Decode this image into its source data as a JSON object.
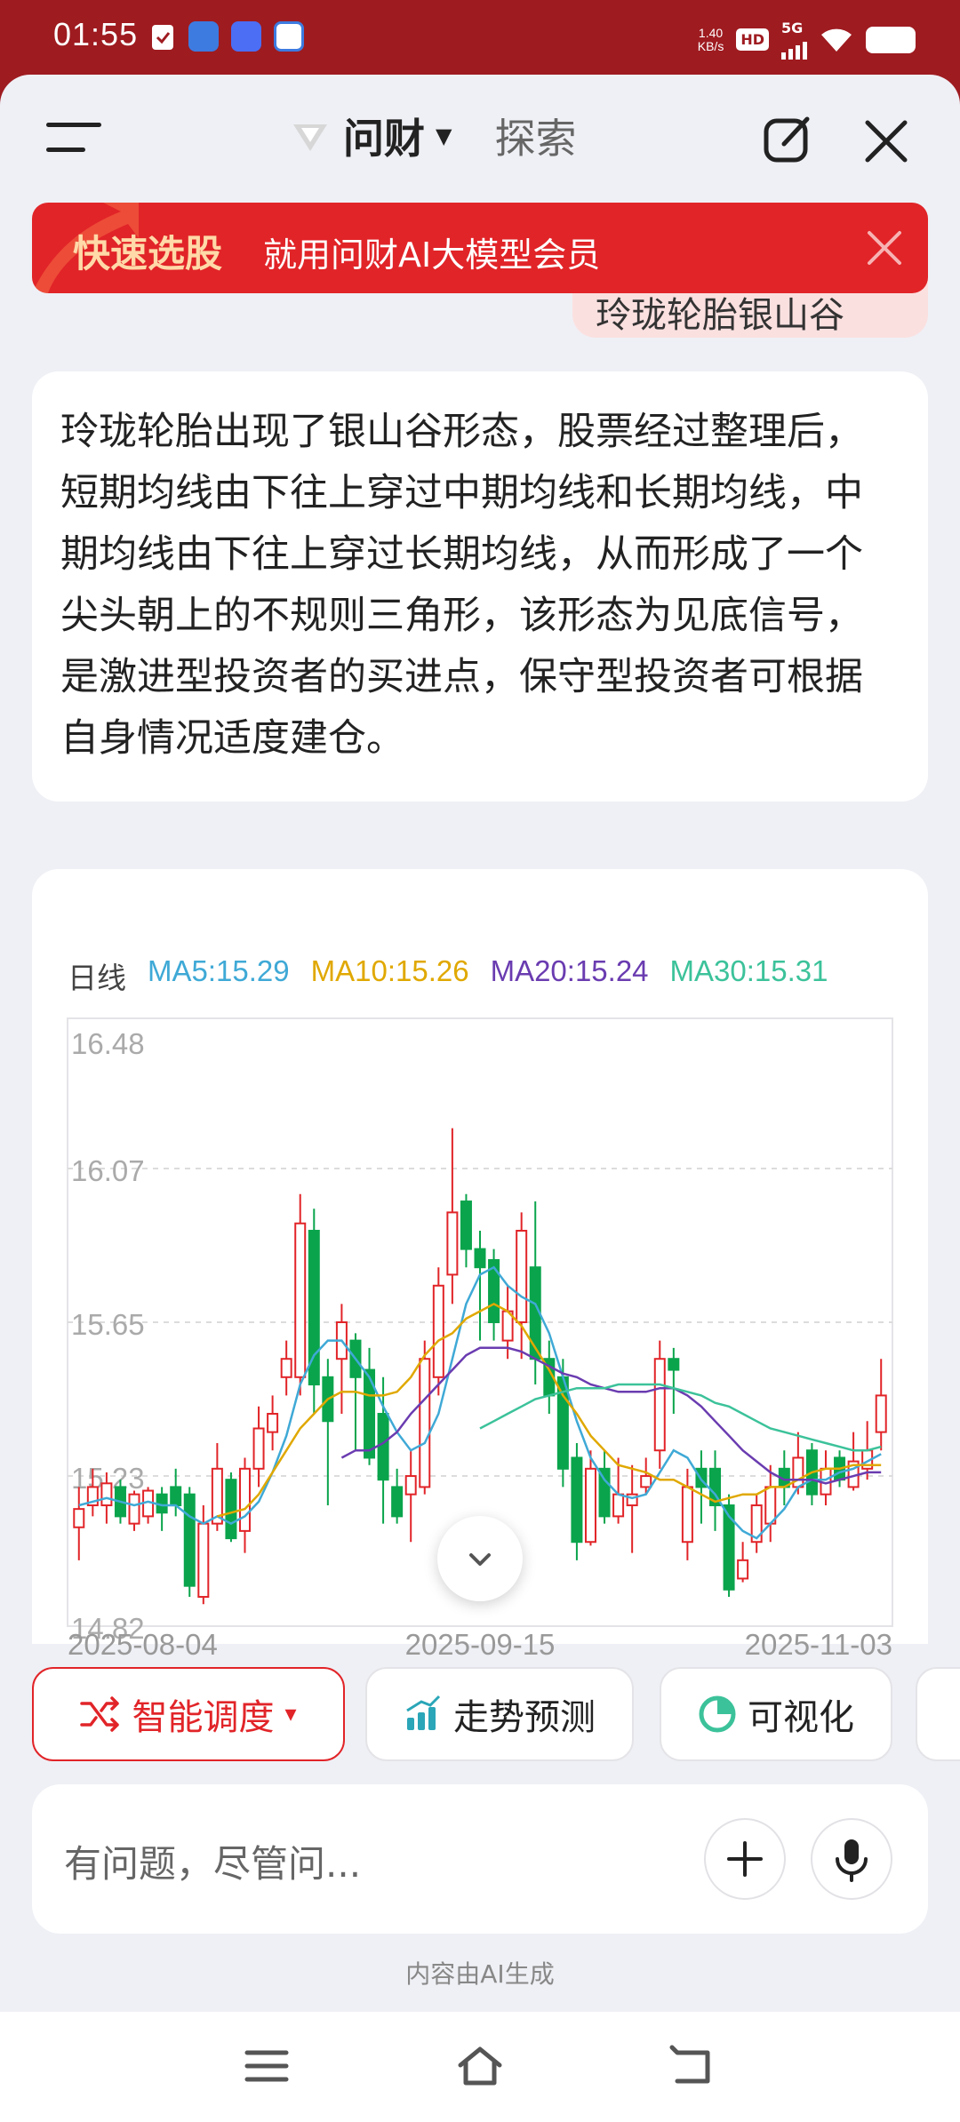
{
  "status_bar": {
    "time": "01:55",
    "net_speed_top": "1.40",
    "net_speed_unit": "KB/s",
    "hd": "HD",
    "network": "5G"
  },
  "header": {
    "brand": "问财",
    "explore": "探索"
  },
  "user_message": {
    "text": "玲珑轮胎银山谷"
  },
  "promo": {
    "title": "快速选股",
    "subtitle": "就用问财AI大模型会员"
  },
  "answer": {
    "text": "玲珑轮胎出现了银山谷形态，股票经过整理后，短期均线由下往上穿过中期均线和长期均线，中期均线由下往上穿过长期均线，从而形成了一个尖头朝上的不规则三角形，该形态为见底信号，是激进型投资者的买进点，保守型投资者可根据自身情况适度建仓。"
  },
  "chart_data": {
    "type": "candlestick",
    "period_label": "日线",
    "ma_legend": [
      {
        "label": "MA5:15.29",
        "color": "#3fa9d6"
      },
      {
        "label": "MA10:15.26",
        "color": "#e0a800"
      },
      {
        "label": "MA20:15.24",
        "color": "#6a3cb0"
      },
      {
        "label": "MA30:15.31",
        "color": "#3cc29a"
      }
    ],
    "y_ticks": [
      "16.48",
      "16.07",
      "15.65",
      "15.23",
      "14.82"
    ],
    "ylim": [
      14.82,
      16.48
    ],
    "x_ticks": [
      "2025-08-04",
      "2025-09-15",
      "2025-11-03"
    ],
    "up_color": "#e12428",
    "down_color": "#0aa44c",
    "candles": [
      {
        "o": 15.09,
        "c": 15.14,
        "h": 15.2,
        "l": 15.0
      },
      {
        "o": 15.15,
        "c": 15.2,
        "h": 15.25,
        "l": 15.12
      },
      {
        "o": 15.15,
        "c": 15.21,
        "h": 15.24,
        "l": 15.1
      },
      {
        "o": 15.2,
        "c": 15.12,
        "h": 15.22,
        "l": 15.1
      },
      {
        "o": 15.1,
        "c": 15.18,
        "h": 15.19,
        "l": 15.08
      },
      {
        "o": 15.12,
        "c": 15.19,
        "h": 15.2,
        "l": 15.1
      },
      {
        "o": 15.18,
        "c": 15.13,
        "h": 15.2,
        "l": 15.08
      },
      {
        "o": 15.2,
        "c": 15.15,
        "h": 15.25,
        "l": 15.12
      },
      {
        "o": 15.18,
        "c": 14.93,
        "h": 15.2,
        "l": 14.9
      },
      {
        "o": 14.9,
        "c": 15.1,
        "h": 15.15,
        "l": 14.88
      },
      {
        "o": 15.1,
        "c": 15.25,
        "h": 15.32,
        "l": 15.08
      },
      {
        "o": 15.22,
        "c": 15.06,
        "h": 15.24,
        "l": 15.05
      },
      {
        "o": 15.08,
        "c": 15.25,
        "h": 15.28,
        "l": 15.02
      },
      {
        "o": 15.25,
        "c": 15.36,
        "h": 15.42,
        "l": 15.2
      },
      {
        "o": 15.35,
        "c": 15.4,
        "h": 15.45,
        "l": 15.3
      },
      {
        "o": 15.5,
        "c": 15.55,
        "h": 15.6,
        "l": 15.45
      },
      {
        "o": 15.5,
        "c": 15.92,
        "h": 16.0,
        "l": 15.45
      },
      {
        "o": 15.9,
        "c": 15.48,
        "h": 15.96,
        "l": 15.4
      },
      {
        "o": 15.5,
        "c": 15.38,
        "h": 15.55,
        "l": 15.15
      },
      {
        "o": 15.55,
        "c": 15.65,
        "h": 15.7,
        "l": 15.4
      },
      {
        "o": 15.6,
        "c": 15.5,
        "h": 15.62,
        "l": 15.3
      },
      {
        "o": 15.52,
        "c": 15.28,
        "h": 15.58,
        "l": 15.26
      },
      {
        "o": 15.4,
        "c": 15.22,
        "h": 15.5,
        "l": 15.1
      },
      {
        "o": 15.2,
        "c": 15.12,
        "h": 15.25,
        "l": 15.1
      },
      {
        "o": 15.18,
        "c": 15.23,
        "h": 15.3,
        "l": 15.05
      },
      {
        "o": 15.2,
        "c": 15.55,
        "h": 15.6,
        "l": 15.18
      },
      {
        "o": 15.5,
        "c": 15.75,
        "h": 15.8,
        "l": 15.45
      },
      {
        "o": 15.78,
        "c": 15.95,
        "h": 16.18,
        "l": 15.7
      },
      {
        "o": 15.98,
        "c": 15.85,
        "h": 16.0,
        "l": 15.8
      },
      {
        "o": 15.85,
        "c": 15.8,
        "h": 15.9,
        "l": 15.6
      },
      {
        "o": 15.82,
        "c": 15.65,
        "h": 15.85,
        "l": 15.6
      },
      {
        "o": 15.6,
        "c": 15.68,
        "h": 15.75,
        "l": 15.55
      },
      {
        "o": 15.65,
        "c": 15.9,
        "h": 15.95,
        "l": 15.55
      },
      {
        "o": 15.8,
        "c": 15.55,
        "h": 15.98,
        "l": 15.48
      },
      {
        "o": 15.55,
        "c": 15.45,
        "h": 15.6,
        "l": 15.4
      },
      {
        "o": 15.5,
        "c": 15.25,
        "h": 15.55,
        "l": 15.2
      },
      {
        "o": 15.28,
        "c": 15.05,
        "h": 15.32,
        "l": 15.0
      },
      {
        "o": 15.05,
        "c": 15.25,
        "h": 15.3,
        "l": 15.04
      },
      {
        "o": 15.25,
        "c": 15.12,
        "h": 15.3,
        "l": 15.1
      },
      {
        "o": 15.12,
        "c": 15.18,
        "h": 15.28,
        "l": 15.1
      },
      {
        "o": 15.15,
        "c": 15.18,
        "h": 15.26,
        "l": 15.02
      },
      {
        "o": 15.2,
        "c": 15.23,
        "h": 15.28,
        "l": 15.18
      },
      {
        "o": 15.3,
        "c": 15.55,
        "h": 15.6,
        "l": 15.25
      },
      {
        "o": 15.55,
        "c": 15.52,
        "h": 15.58,
        "l": 15.4
      },
      {
        "o": 15.05,
        "c": 15.2,
        "h": 15.25,
        "l": 15.0
      },
      {
        "o": 15.25,
        "c": 15.2,
        "h": 15.3,
        "l": 15.1
      },
      {
        "o": 15.25,
        "c": 15.15,
        "h": 15.3,
        "l": 15.08
      },
      {
        "o": 15.15,
        "c": 14.92,
        "h": 15.18,
        "l": 14.9
      },
      {
        "o": 14.95,
        "c": 15.0,
        "h": 15.05,
        "l": 14.94
      },
      {
        "o": 15.05,
        "c": 15.15,
        "h": 15.18,
        "l": 15.02
      },
      {
        "o": 15.1,
        "c": 15.2,
        "h": 15.26,
        "l": 15.05
      },
      {
        "o": 15.25,
        "c": 15.2,
        "h": 15.3,
        "l": 15.15
      },
      {
        "o": 15.2,
        "c": 15.28,
        "h": 15.35,
        "l": 15.18
      },
      {
        "o": 15.3,
        "c": 15.18,
        "h": 15.32,
        "l": 15.15
      },
      {
        "o": 15.18,
        "c": 15.25,
        "h": 15.3,
        "l": 15.15
      },
      {
        "o": 15.28,
        "c": 15.22,
        "h": 15.3,
        "l": 15.2
      },
      {
        "o": 15.2,
        "c": 15.27,
        "h": 15.35,
        "l": 15.19
      },
      {
        "o": 15.25,
        "c": 15.3,
        "h": 15.38,
        "l": 15.22
      },
      {
        "o": 15.35,
        "c": 15.45,
        "h": 15.55,
        "l": 15.3
      }
    ],
    "ma_series": [
      {
        "name": "MA5",
        "color": "#3fa9d6",
        "start": 0,
        "values": [
          15.15,
          15.16,
          15.17,
          15.16,
          15.15,
          15.16,
          15.15,
          15.15,
          15.12,
          15.1,
          15.12,
          15.1,
          15.12,
          15.16,
          15.24,
          15.34,
          15.48,
          15.56,
          15.6,
          15.6,
          15.55,
          15.5,
          15.42,
          15.35,
          15.3,
          15.32,
          15.4,
          15.55,
          15.7,
          15.78,
          15.8,
          15.75,
          15.72,
          15.7,
          15.62,
          15.5,
          15.38,
          15.28,
          15.22,
          15.18,
          15.17,
          15.18,
          15.24,
          15.3,
          15.28,
          15.22,
          15.18,
          15.12,
          15.08,
          15.06,
          15.1,
          15.14,
          15.2,
          15.22,
          15.22,
          15.24,
          15.25,
          15.27,
          15.29
        ]
      },
      {
        "name": "MA10",
        "color": "#e0a800",
        "start": 10,
        "values": [
          15.12,
          15.13,
          15.14,
          15.18,
          15.24,
          15.3,
          15.36,
          15.4,
          15.44,
          15.46,
          15.46,
          15.45,
          15.45,
          15.46,
          15.5,
          15.56,
          15.6,
          15.62,
          15.66,
          15.68,
          15.7,
          15.68,
          15.64,
          15.58,
          15.52,
          15.45,
          15.4,
          15.34,
          15.3,
          15.26,
          15.25,
          15.24,
          15.22,
          15.22,
          15.2,
          15.18,
          15.16,
          15.17,
          15.18,
          15.18,
          15.2,
          15.2,
          15.22,
          15.24,
          15.25,
          15.25,
          15.26,
          15.26,
          15.26
        ]
      },
      {
        "name": "MA20",
        "color": "#6a3cb0",
        "start": 19,
        "values": [
          15.28,
          15.3,
          15.3,
          15.32,
          15.35,
          15.4,
          15.44,
          15.48,
          15.52,
          15.56,
          15.58,
          15.58,
          15.58,
          15.57,
          15.55,
          15.53,
          15.51,
          15.5,
          15.48,
          15.47,
          15.46,
          15.46,
          15.46,
          15.47,
          15.47,
          15.45,
          15.42,
          15.38,
          15.34,
          15.3,
          15.27,
          15.24,
          15.22,
          15.22,
          15.22,
          15.21,
          15.22,
          15.23,
          15.24,
          15.24
        ]
      },
      {
        "name": "MA30",
        "color": "#3cc29a",
        "start": 29,
        "values": [
          15.36,
          15.38,
          15.4,
          15.42,
          15.44,
          15.45,
          15.46,
          15.47,
          15.47,
          15.47,
          15.48,
          15.48,
          15.48,
          15.48,
          15.47,
          15.46,
          15.45,
          15.43,
          15.42,
          15.4,
          15.38,
          15.36,
          15.35,
          15.34,
          15.33,
          15.32,
          15.31,
          15.3,
          15.3,
          15.31
        ]
      }
    ]
  },
  "chips": [
    {
      "label": "智能调度",
      "caret": "▾"
    },
    {
      "label": "走势预测"
    },
    {
      "label": "可视化"
    }
  ],
  "input": {
    "placeholder": "有问题，尽管问..."
  },
  "disclaimer": "内容由AI生成"
}
